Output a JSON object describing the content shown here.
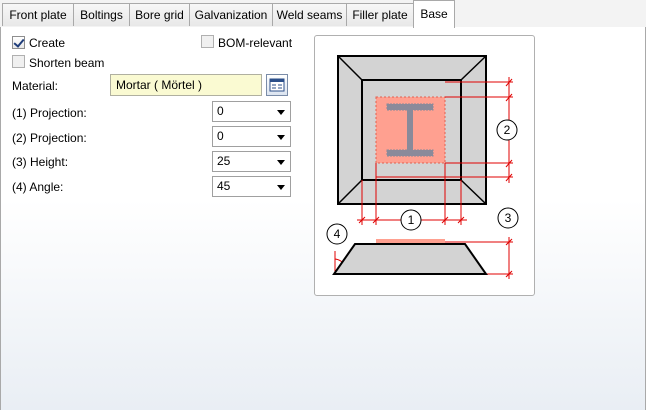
{
  "tabs": [
    {
      "label": "Front plate",
      "active": false
    },
    {
      "label": "Boltings",
      "active": false
    },
    {
      "label": "Bore grid",
      "active": false
    },
    {
      "label": "Galvanization",
      "active": false
    },
    {
      "label": "Weld seams",
      "active": false
    },
    {
      "label": "Filler plate",
      "active": false
    },
    {
      "label": "Base",
      "active": true
    }
  ],
  "options": {
    "create_label": "Create",
    "create_checked": true,
    "bom_label": "BOM-relevant",
    "bom_checked": false,
    "shorten_label": "Shorten beam",
    "shorten_checked": false
  },
  "material": {
    "label": "Material:",
    "value": "Mortar  ( Mörtel )",
    "button_icon": "catalog-icon"
  },
  "fields": [
    {
      "label": "(1) Projection:",
      "value": "0"
    },
    {
      "label": "(2) Projection:",
      "value": "0"
    },
    {
      "label": "(3) Height:",
      "value": "25"
    },
    {
      "label": "(4) Angle:",
      "value": "45"
    }
  ],
  "diagram": {
    "callouts": [
      "1",
      "2",
      "3",
      "4"
    ],
    "colors": {
      "base_fill": "#d3d3d3",
      "plate_fill": "#ffa090",
      "beam_fill": "#8a8a9a",
      "dimension": "#e00000"
    }
  }
}
